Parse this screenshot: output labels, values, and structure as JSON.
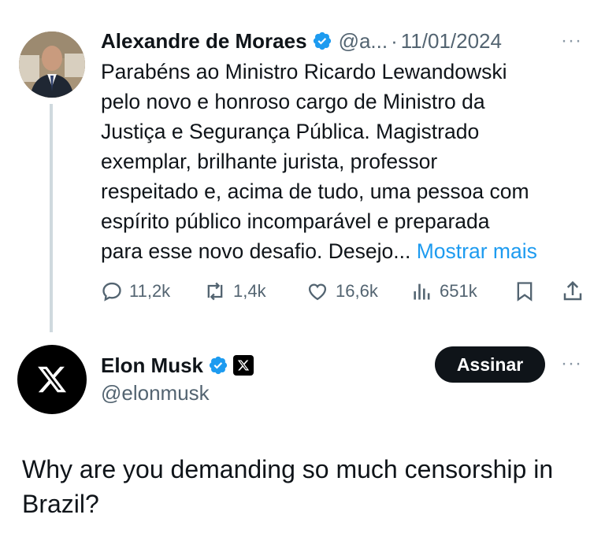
{
  "tweet1": {
    "author_name": "Alexandre de Moraes",
    "handle": "@a...",
    "separator": "·",
    "date": "11/01/2024",
    "more_label": "···",
    "body_lines": [
      "Parabéns ao Ministro Ricardo Lewandowski",
      "pelo novo e honroso cargo de Ministro da",
      "Justiça e Segurança Pública. Magistrado",
      "exemplar, brilhante jurista, professor",
      "respeitado e, acima de tudo, uma pessoa com",
      "espírito público incomparável e preparada"
    ],
    "last_line_text": "para esse novo desafio. Desejo...",
    "show_more": "Mostrar mais",
    "stats": {
      "replies": "11,2k",
      "reposts": "1,4k",
      "likes": "16,6k",
      "views": "651k"
    }
  },
  "tweet2": {
    "author_name": "Elon Musk",
    "handle": "@elonmusk",
    "follow_label": "Assinar",
    "more_label": "···",
    "body_lines": [
      "Why are you demanding so much censorship in",
      "Brazil?"
    ]
  },
  "colors": {
    "text": "#0f1419",
    "secondary": "#536471",
    "link": "#1d9bf0",
    "verified": "#1d9bf0",
    "thread_line": "#cfd9de",
    "button_bg": "#0f1419"
  },
  "icons": {
    "verified": "verified-badge-icon",
    "reply": "reply-icon",
    "repost": "repost-icon",
    "like": "heart-icon",
    "views": "views-icon",
    "bookmark": "bookmark-icon",
    "share": "share-icon",
    "x_logo": "x-logo-icon"
  }
}
